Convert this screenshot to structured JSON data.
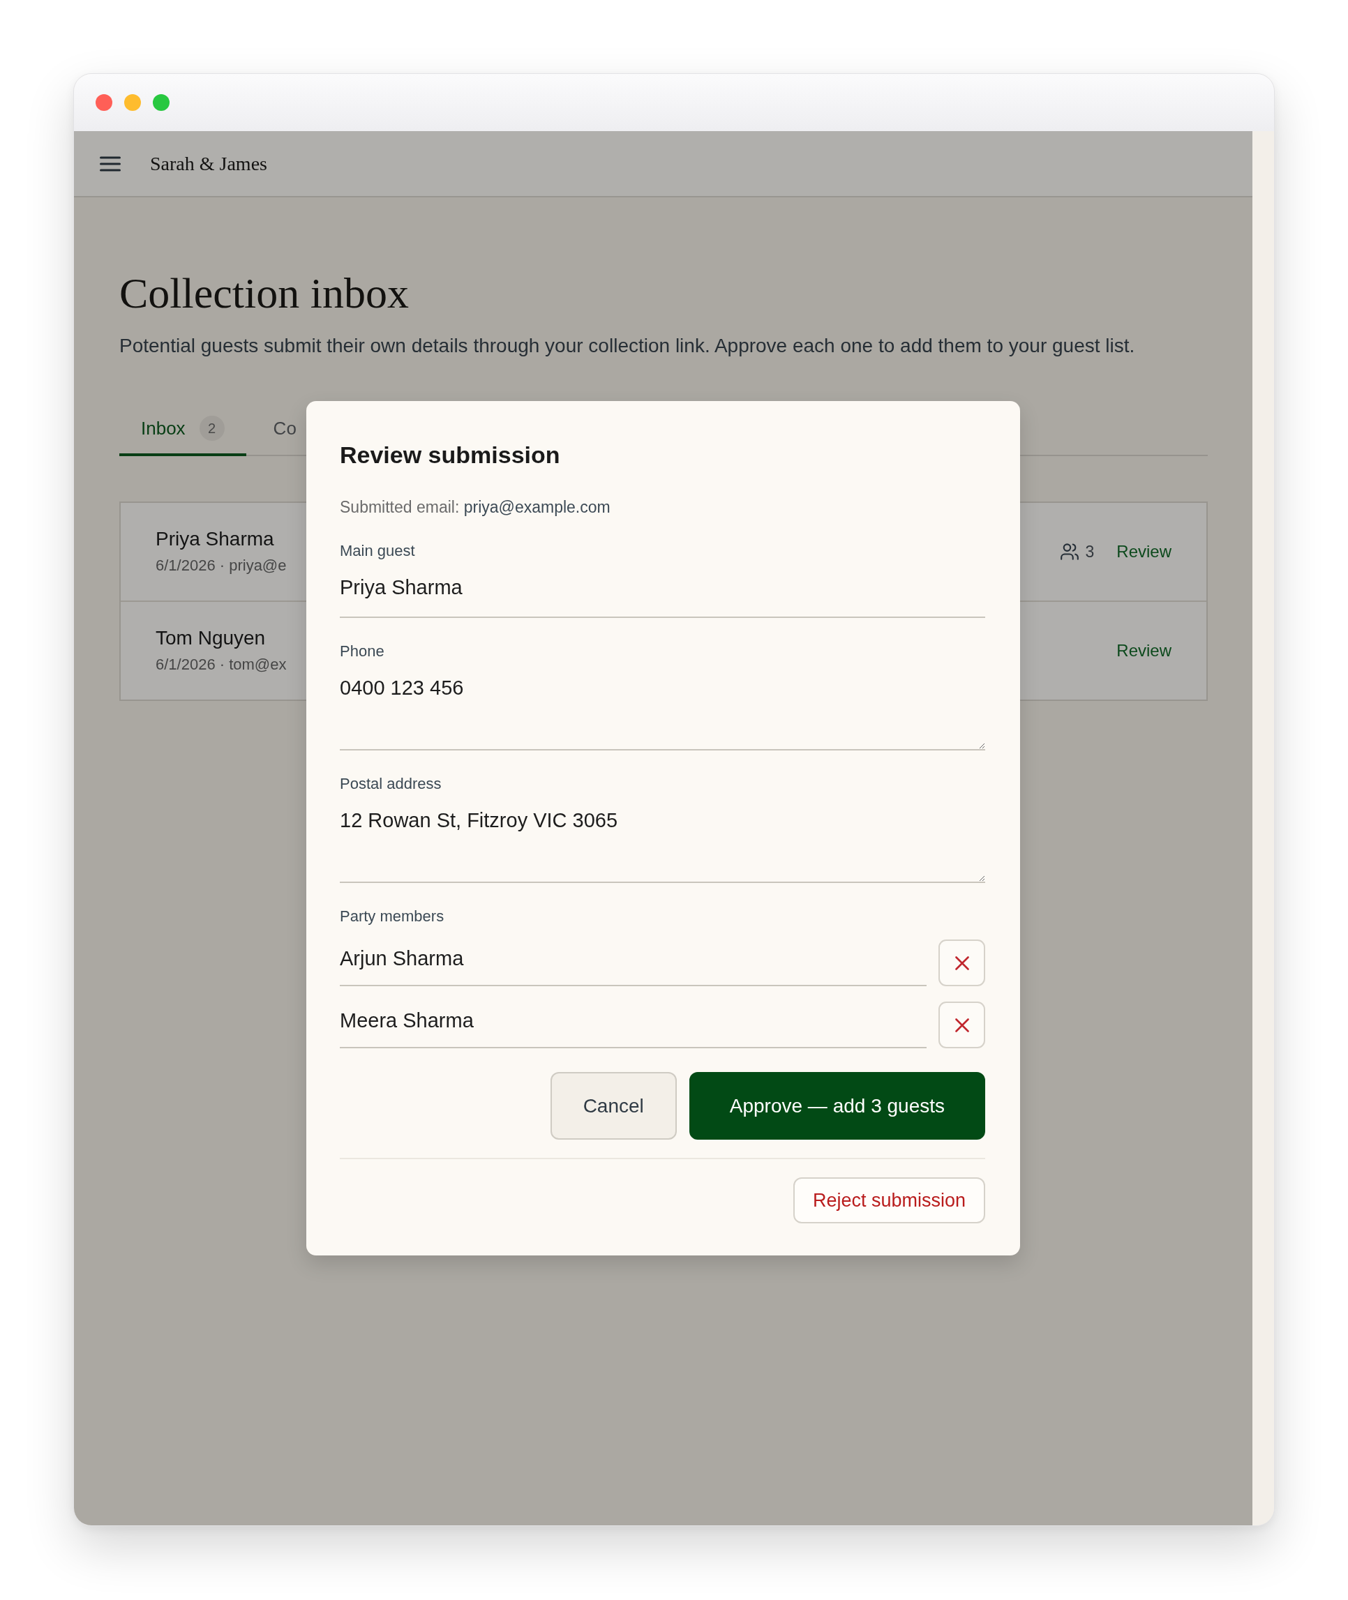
{
  "header": {
    "brand": "Sarah & James"
  },
  "page": {
    "title": "Collection inbox",
    "description": "Potential guests submit their own details through your collection link. Approve each one to add them to your guest list."
  },
  "tabs": [
    {
      "label": "Inbox",
      "count": "2",
      "selected": true
    },
    {
      "label": "Co",
      "selected": false
    }
  ],
  "submissions": [
    {
      "name": "Priya Sharma",
      "meta": "6/1/2026 · priya@e",
      "party_size": "3",
      "action": "Review"
    },
    {
      "name": "Tom Nguyen",
      "meta": "6/1/2026 · tom@ex",
      "action": "Review"
    }
  ],
  "dialog": {
    "title": "Review submission",
    "submitted_email": {
      "label": "Submitted email:",
      "value": "priya@example.com"
    },
    "fields": [
      {
        "kind": "text",
        "label": "Main guest",
        "value": "Priya Sharma"
      },
      {
        "kind": "multiline",
        "label": "Phone",
        "value": "0400 123 456"
      },
      {
        "kind": "multiline",
        "label": "Postal address",
        "value": "12 Rowan St, Fitzroy VIC 3065"
      }
    ],
    "party_members": {
      "label": "Party members",
      "members": [
        {
          "value": "Arjun Sharma"
        },
        {
          "value": "Meera Sharma"
        }
      ]
    },
    "actions": [
      {
        "kind": "secondary",
        "label": "Cancel"
      },
      {
        "kind": "primary",
        "label": "Approve — add 3 guests"
      }
    ],
    "footer_actions": [
      {
        "kind": "danger",
        "label": "Reject submission"
      }
    ]
  }
}
